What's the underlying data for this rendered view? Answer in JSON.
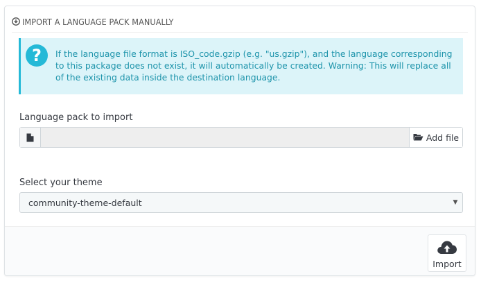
{
  "panel": {
    "heading": "IMPORT A LANGUAGE PACK MANUALLY",
    "heading_icon": "download-circle-icon"
  },
  "info": {
    "icon": "question-icon",
    "message": "If the language file format is ISO_code.gzip (e.g. \"us.gzip\"), and the language corresponding to this package does not exist, it will automatically be created. Warning: This will replace all of the existing data inside the destination language."
  },
  "language_pack": {
    "label": "Language pack to import",
    "value": "",
    "file_icon": "file-icon",
    "add_file_label": "Add file",
    "add_file_icon": "folder-open-icon"
  },
  "theme": {
    "label": "Select your theme",
    "selected": "community-theme-default"
  },
  "footer": {
    "import_label": "Import",
    "import_icon": "cloud-upload-icon"
  },
  "colors": {
    "accent": "#25b9d7",
    "info_bg": "#dcf4f9",
    "info_text": "#1e94ab"
  }
}
